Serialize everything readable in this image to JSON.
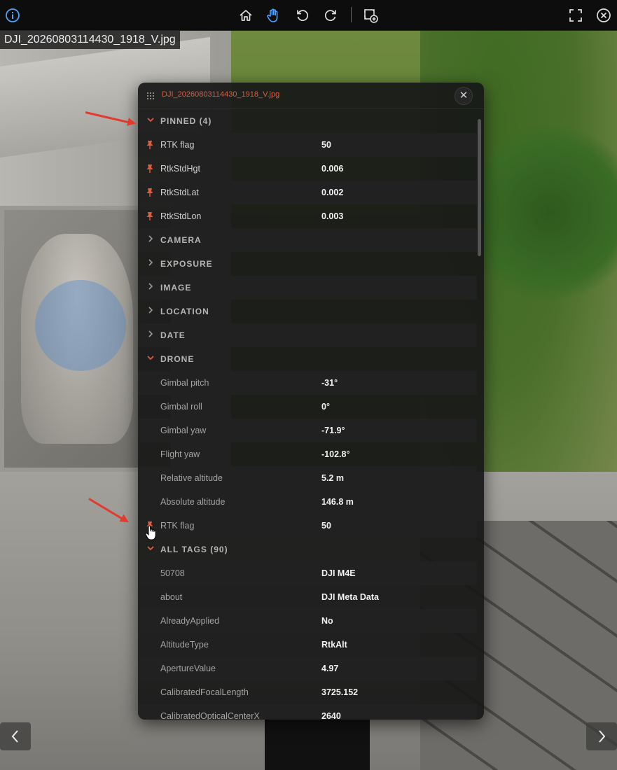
{
  "toolbar": {
    "icons": [
      "info-icon",
      "home-icon",
      "hand-pan-icon",
      "rotate-left-icon",
      "rotate-right-icon",
      "add-frame-icon",
      "fullscreen-icon",
      "close-icon"
    ],
    "active_color": "#4da3ff"
  },
  "image": {
    "filename": "DJI_20260803114430_1918_V.jpg"
  },
  "panel": {
    "title": "DJI_20260803114430_1918_V.jpg",
    "close_label": "✕",
    "pinned": {
      "label": "PINNED (4)",
      "rows": [
        {
          "key": "RTK flag",
          "value": "50"
        },
        {
          "key": "RtkStdHgt",
          "value": "0.006"
        },
        {
          "key": "RtkStdLat",
          "value": "0.002"
        },
        {
          "key": "RtkStdLon",
          "value": "0.003"
        }
      ]
    },
    "sections_collapsed": [
      "CAMERA",
      "EXPOSURE",
      "IMAGE",
      "LOCATION",
      "DATE"
    ],
    "drone": {
      "label": "DRONE",
      "rows": [
        {
          "key": "Gimbal pitch",
          "value": "-31°"
        },
        {
          "key": "Gimbal roll",
          "value": "0°"
        },
        {
          "key": "Gimbal yaw",
          "value": "-71.9°"
        },
        {
          "key": "Flight yaw",
          "value": "-102.8°"
        },
        {
          "key": "Relative altitude",
          "value": "5.2 m"
        },
        {
          "key": "Absolute altitude",
          "value": "146.8 m"
        },
        {
          "key": "RTK flag",
          "value": "50"
        }
      ]
    },
    "all_tags": {
      "label": "ALL TAGS (90)",
      "rows": [
        {
          "key": "50708",
          "value": "DJI M4E"
        },
        {
          "key": "about",
          "value": "DJI Meta Data"
        },
        {
          "key": "AlreadyApplied",
          "value": "No"
        },
        {
          "key": "AltitudeType",
          "value": "RtkAlt"
        },
        {
          "key": "ApertureValue",
          "value": "4.97"
        },
        {
          "key": "CalibratedFocalLength",
          "value": "3725.152"
        },
        {
          "key": "CalibratedOpticalCenterX",
          "value": "2640"
        }
      ]
    }
  },
  "colors": {
    "accent": "#e25b3a",
    "annotation_arrow": "#e23b2e"
  }
}
